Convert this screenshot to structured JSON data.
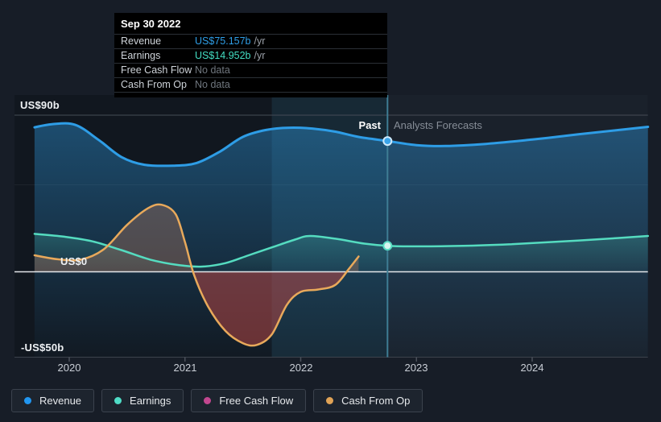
{
  "colors": {
    "page_bg": "#171d27",
    "plot_bg": "#11171f",
    "forecast_bg": "#1a212b",
    "hover_band": "rgba(77,175,212,0.12)",
    "divider": "#3e7d94",
    "zero_line": "#e3e6e9",
    "grid_strong": "#454c56",
    "grid_faint": "rgba(255,255,255,0.055)",
    "grid_bottom": "#3d434d",
    "tick": "#4a505a"
  },
  "tooltip": {
    "title": "Sep 30 2022",
    "rows": [
      {
        "label": "Revenue",
        "value": "US$75.157b",
        "suffix": "/yr",
        "value_color": "#2f9fe8"
      },
      {
        "label": "Earnings",
        "value": "US$14.952b",
        "suffix": "/yr",
        "value_color": "#43dec3"
      },
      {
        "label": "Free Cash Flow",
        "value": "No data",
        "suffix": "",
        "value_color": "#70777f"
      },
      {
        "label": "Cash From Op",
        "value": "No data",
        "suffix": "",
        "value_color": "#70777f"
      }
    ]
  },
  "legend": {
    "items": [
      {
        "label": "Revenue",
        "color": "#2196f0"
      },
      {
        "label": "Earnings",
        "color": "#4fdcc6"
      },
      {
        "label": "Free Cash Flow",
        "color": "#c2478f"
      },
      {
        "label": "Cash From Op",
        "color": "#e0a356"
      }
    ]
  },
  "chart_data": {
    "type": "area",
    "x_unit": "year",
    "x_ticks": [
      2020,
      2021,
      2022,
      2023,
      2024
    ],
    "x_tick_labels": [
      "2020",
      "2021",
      "2022",
      "2023",
      "2024"
    ],
    "xlim": [
      2019.7,
      2025.0
    ],
    "ylim": [
      -50,
      90
    ],
    "y_gridlines": [
      {
        "value": 90,
        "label": "US$90b"
      },
      {
        "value": 50,
        "label": ""
      },
      {
        "value": 0,
        "label": "US$0"
      },
      {
        "value": -50,
        "label": "-US$50b"
      }
    ],
    "divider_x": 2022.75,
    "hover_band": [
      2021.75,
      2022.75
    ],
    "past_label": "Past",
    "forecast_label": "Analysts Forecasts",
    "series": [
      {
        "name": "Revenue",
        "color": "#2e9de6",
        "unit": "US$ billions / yr",
        "fill": "gradient_to_bottom",
        "divider_value": 75.157,
        "marker_style": {
          "fill": "#3aa4e8",
          "stroke": "#cfeafb"
        },
        "points": [
          [
            2019.7,
            83.0
          ],
          [
            2019.85,
            84.8
          ],
          [
            2020.05,
            84.5
          ],
          [
            2020.25,
            76.0
          ],
          [
            2020.45,
            66.0
          ],
          [
            2020.65,
            61.5
          ],
          [
            2020.9,
            61.0
          ],
          [
            2021.1,
            62.5
          ],
          [
            2021.3,
            69.0
          ],
          [
            2021.5,
            77.5
          ],
          [
            2021.7,
            81.5
          ],
          [
            2021.9,
            82.8
          ],
          [
            2022.1,
            82.3
          ],
          [
            2022.3,
            80.5
          ],
          [
            2022.5,
            77.5
          ],
          [
            2022.75,
            75.157
          ],
          [
            2023.0,
            72.8
          ],
          [
            2023.25,
            72.3
          ],
          [
            2023.6,
            73.5
          ],
          [
            2024.0,
            76.0
          ],
          [
            2024.4,
            79.0
          ],
          [
            2024.75,
            81.5
          ],
          [
            2025.0,
            83.3
          ]
        ]
      },
      {
        "name": "Earnings",
        "color": "#55dcc0",
        "unit": "US$ billions / yr",
        "fill": "gradient_to_zero",
        "divider_value": 14.952,
        "marker_style": {
          "fill": "#d8f6ef",
          "stroke": "#5adcc2"
        },
        "points": [
          [
            2019.7,
            21.8
          ],
          [
            2019.95,
            20.2
          ],
          [
            2020.2,
            17.5
          ],
          [
            2020.45,
            12.5
          ],
          [
            2020.7,
            7.0
          ],
          [
            2020.95,
            3.8
          ],
          [
            2021.15,
            3.0
          ],
          [
            2021.35,
            5.0
          ],
          [
            2021.55,
            9.5
          ],
          [
            2021.75,
            14.0
          ],
          [
            2021.95,
            18.5
          ],
          [
            2022.08,
            20.6
          ],
          [
            2022.3,
            19.0
          ],
          [
            2022.55,
            16.2
          ],
          [
            2022.75,
            14.952
          ],
          [
            2023.0,
            14.6
          ],
          [
            2023.4,
            14.9
          ],
          [
            2023.8,
            15.8
          ],
          [
            2024.2,
            17.2
          ],
          [
            2024.6,
            18.8
          ],
          [
            2025.0,
            20.6
          ]
        ]
      },
      {
        "name": "Free Cash Flow",
        "color": "#c2478f",
        "unit": "US$ billions / yr",
        "fill": "none",
        "points": []
      },
      {
        "name": "Cash From Op",
        "color": "#e8a95b",
        "unit": "US$ billions / yr",
        "fill": "signed_to_zero",
        "fill_pos": "rgba(184,122,94,0.36)",
        "fill_neg": "rgba(194,71,68,0.50)",
        "points": [
          [
            2019.7,
            9.5
          ],
          [
            2019.9,
            7.2
          ],
          [
            2020.1,
            7.0
          ],
          [
            2020.3,
            13.0
          ],
          [
            2020.5,
            27.0
          ],
          [
            2020.68,
            36.5
          ],
          [
            2020.8,
            38.5
          ],
          [
            2020.92,
            33.0
          ],
          [
            2021.0,
            17.0
          ],
          [
            2021.08,
            -2.0
          ],
          [
            2021.2,
            -20.0
          ],
          [
            2021.35,
            -34.0
          ],
          [
            2021.5,
            -41.0
          ],
          [
            2021.62,
            -42.0
          ],
          [
            2021.75,
            -36.0
          ],
          [
            2021.88,
            -19.0
          ],
          [
            2022.0,
            -11.5
          ],
          [
            2022.15,
            -10.2
          ],
          [
            2022.3,
            -7.5
          ],
          [
            2022.42,
            2.0
          ],
          [
            2022.5,
            8.8
          ]
        ]
      }
    ]
  }
}
